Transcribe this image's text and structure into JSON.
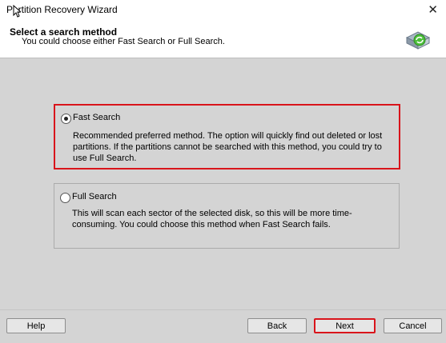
{
  "window": {
    "title": "Partition Recovery Wizard",
    "close_glyph": "✕"
  },
  "header": {
    "title": "Select a search method",
    "subtitle": "You could choose either Fast Search or Full Search.",
    "icon": "disk-recovery-icon"
  },
  "options": [
    {
      "label": "Fast Search",
      "description": "Recommended preferred method. The option will quickly find out deleted or lost partitions. If the partitions cannot be searched with this method, you could try to use Full Search.",
      "selected": true,
      "highlight_color": "#d9141b"
    },
    {
      "label": "Full Search",
      "description": "This will scan each sector of the selected disk, so this will be more time-consuming. You could choose this method when Fast Search fails.",
      "selected": false
    }
  ],
  "footer": {
    "help_label": "Help",
    "back_label": "Back",
    "next_label": "Next",
    "cancel_label": "Cancel"
  }
}
